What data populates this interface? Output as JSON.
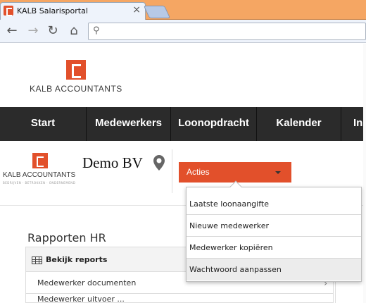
{
  "browser": {
    "tab_title": "KALB Salarisportal",
    "close_glyph": "×",
    "back_glyph": "←",
    "forward_glyph": "→",
    "reload_glyph": "↻",
    "home_glyph": "⌂",
    "search_glyph": "⚲",
    "address_value": ""
  },
  "header": {
    "logo_text": "KALB ACCOUNTANTS"
  },
  "nav": {
    "items": [
      {
        "label": "Start"
      },
      {
        "label": "Medewerkers"
      },
      {
        "label": "Loonopdracht"
      },
      {
        "label": "Kalender"
      },
      {
        "label": "Ins"
      }
    ]
  },
  "company": {
    "logo_text": "KALB ACCOUNTANTS",
    "logo_tagline": "BEDRIJVEN · BETROKKEN · ONDERNEMEND",
    "name": "Demo BV"
  },
  "actions": {
    "label": "Acties",
    "menu": [
      {
        "label": "Laatste loonaangifte"
      },
      {
        "label": "Nieuwe medewerker"
      },
      {
        "label": "Medewerker kopiëren"
      },
      {
        "label": "Wachtwoord aanpassen"
      }
    ]
  },
  "reports": {
    "section_title": "Rapporten HR",
    "header_label": "Bekijk reports",
    "rows": [
      {
        "label": "Medewerker documenten"
      },
      {
        "label": "Medewerker uitvoer ..."
      }
    ]
  },
  "colors": {
    "brand": "#e2502b",
    "nav_bg": "#2b2b2b",
    "chrome_frame": "#f5a663"
  },
  "icons": [
    "kalb-logo-icon",
    "map-pin-icon",
    "grid-icon",
    "chevron-right-icon",
    "caret-down-icon"
  ]
}
